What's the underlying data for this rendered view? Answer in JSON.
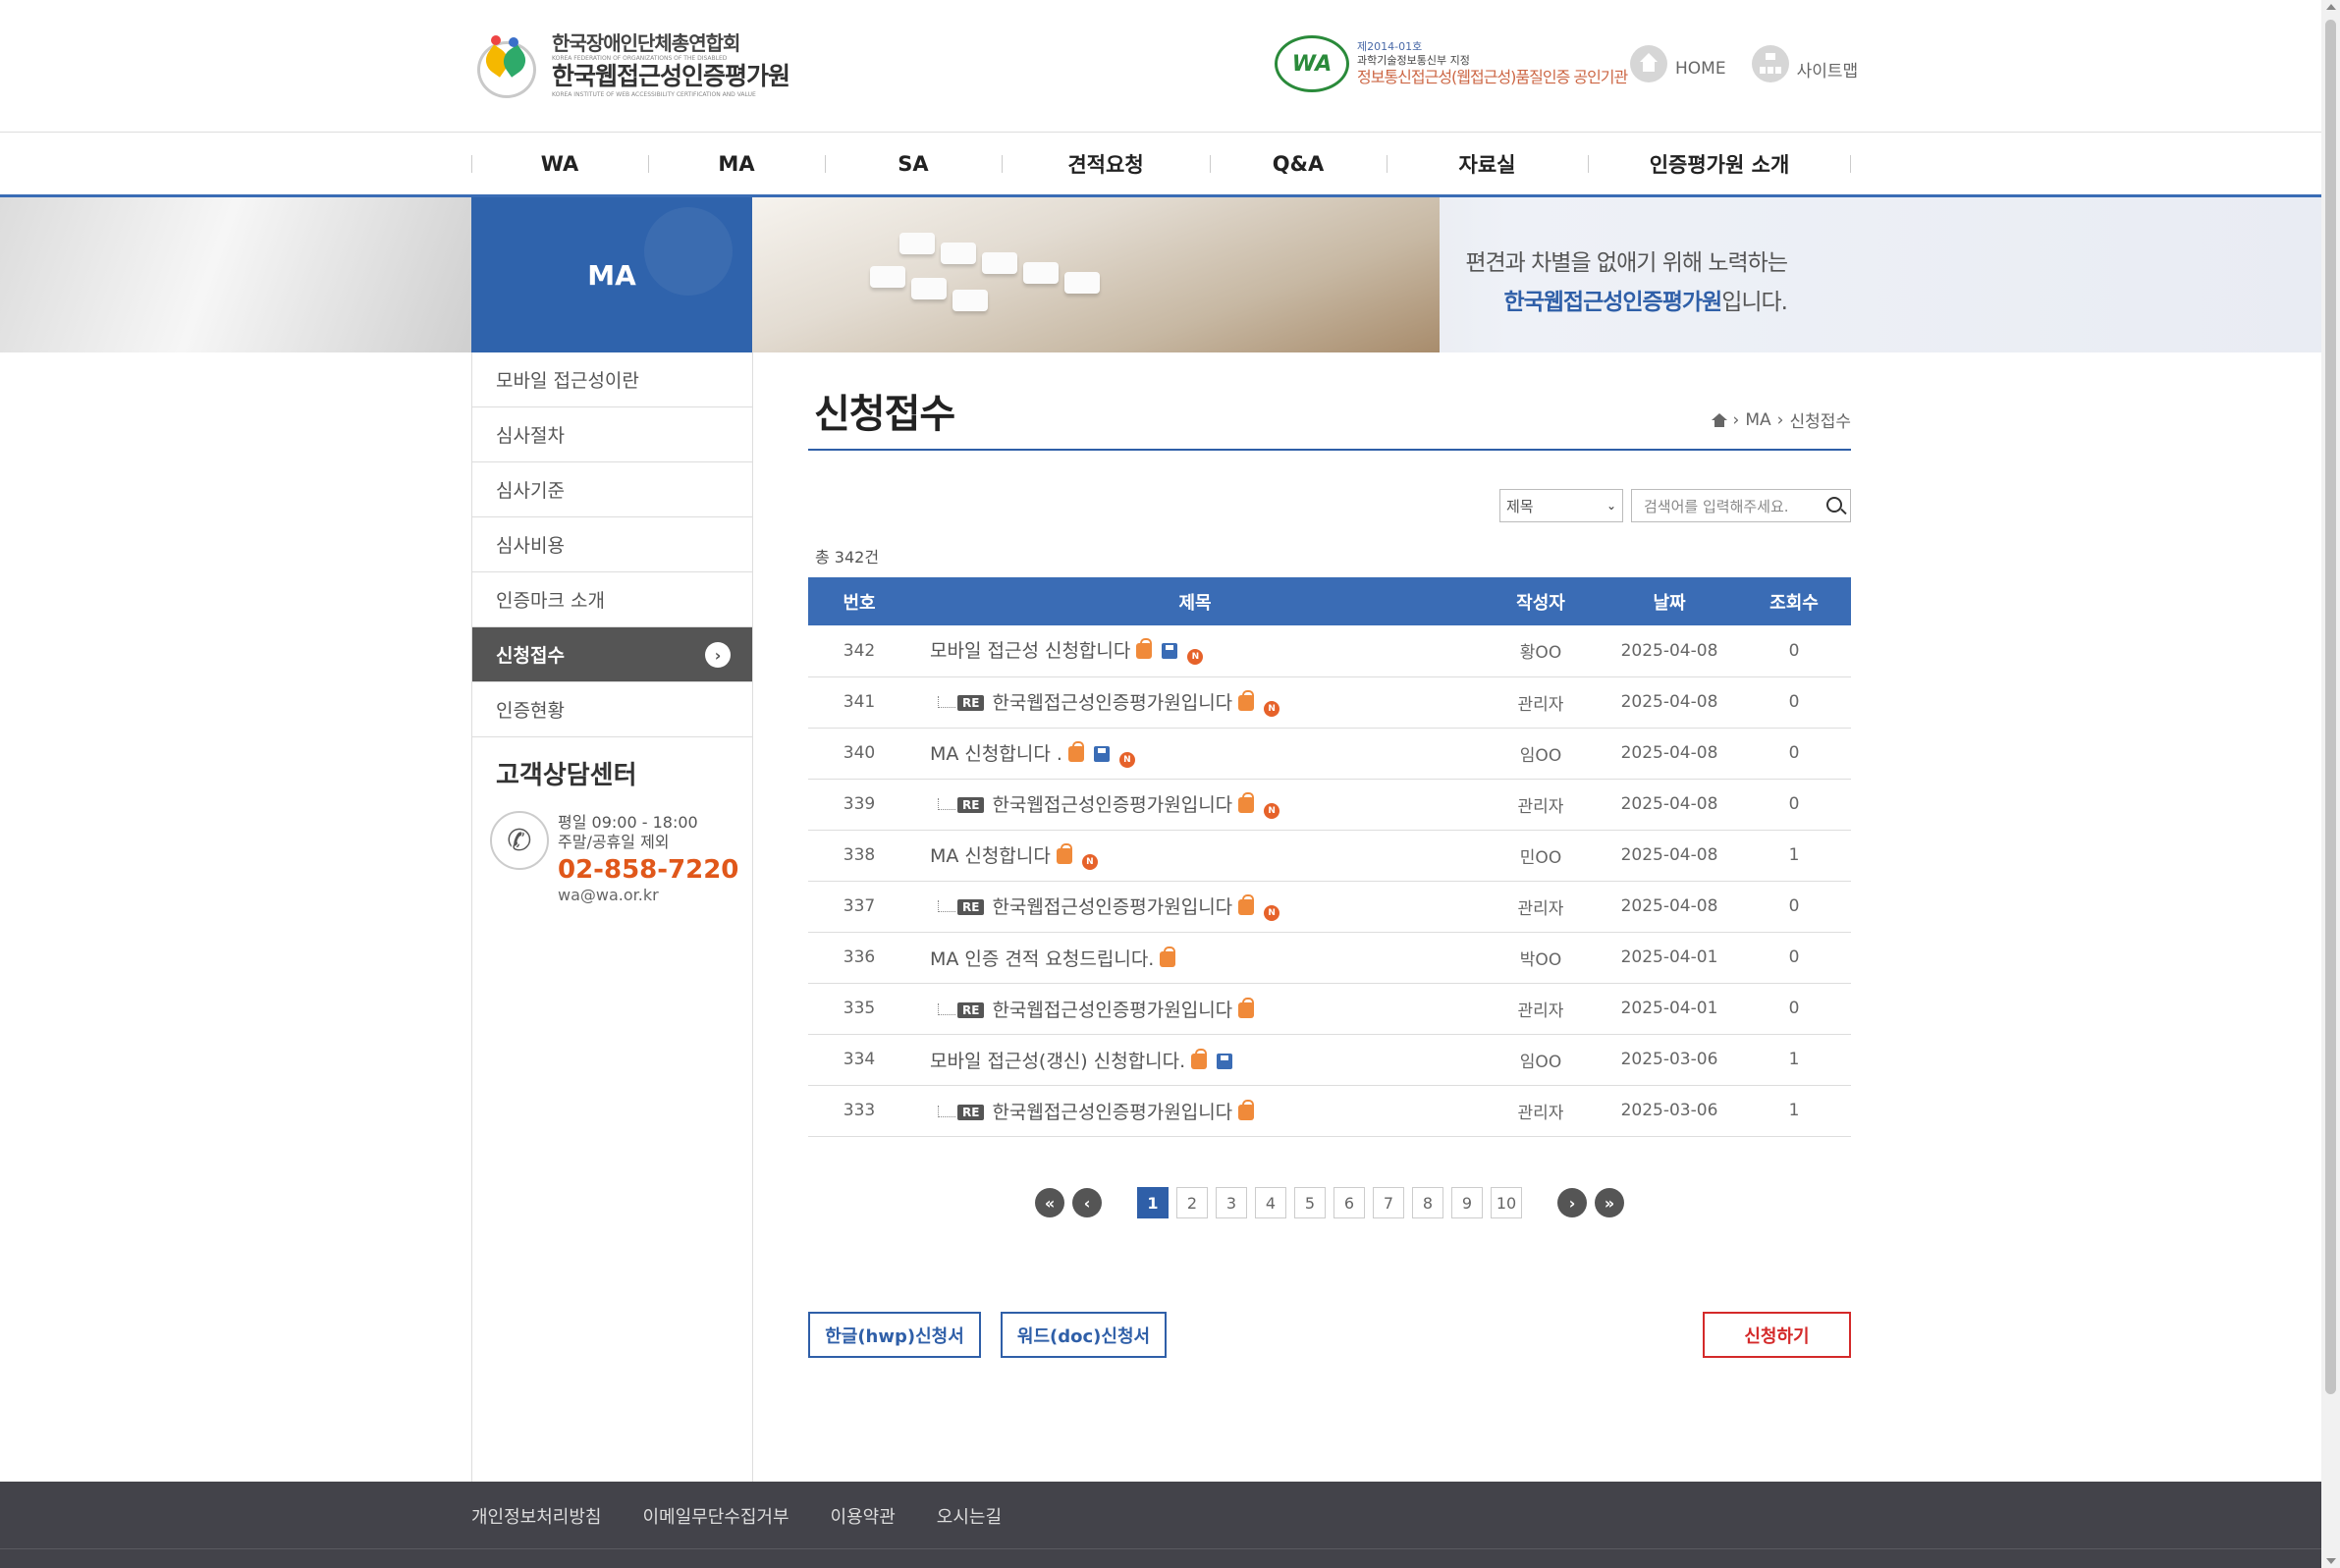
{
  "header": {
    "logo_line1": "한국장애인단체총연합회",
    "logo_line1_en": "KOREA FEDERATION OF ORGANIZATIONS OF THE DISABLED",
    "logo_line2": "한국웹접근성인증평가원",
    "logo_line2_en": "KOREA INSTITUTE OF WEB ACCESSIBILITY CERTIFICATION AND VALUE",
    "badge_mark": "WA",
    "badge_line1": "제2014-01호",
    "badge_line2": "과학기술정보통신부 지정",
    "badge_line3": "정보통신접근성(웹접근성)품질인증 공인기관",
    "home_label": "HOME",
    "sitemap_label": "사이트맵"
  },
  "gnb": {
    "items": [
      "WA",
      "MA",
      "SA",
      "견적요청",
      "Q&A",
      "자료실",
      "인증평가원 소개"
    ]
  },
  "visual": {
    "section_label": "MA",
    "slogan_line1": "편견과 차별을 없애기 위해 노력하는",
    "slogan_line2_bold": "한국웹접근성인증평가원",
    "slogan_line2_rest": "입니다."
  },
  "sidebar": {
    "items": [
      {
        "label": "모바일 접근성이란",
        "active": false
      },
      {
        "label": "심사절차",
        "active": false
      },
      {
        "label": "심사기준",
        "active": false
      },
      {
        "label": "심사비용",
        "active": false
      },
      {
        "label": "인증마크 소개",
        "active": false
      },
      {
        "label": "신청접수",
        "active": true
      },
      {
        "label": "인증현황",
        "active": false
      }
    ],
    "cs_title": "고객상담센터",
    "cs_hours1": "평일 09:00 - 18:00",
    "cs_hours2": "주말/공휴일 제외",
    "cs_phone": "02-858-7220",
    "cs_email": "wa@wa.or.kr"
  },
  "content": {
    "page_title": "신청접수",
    "breadcrumb_section": "MA",
    "breadcrumb_current": "신청접수",
    "search_select": "제목",
    "search_placeholder": "검색어를 입력해주세요.",
    "total_text": "총 342건"
  },
  "board": {
    "headers": [
      "번호",
      "제목",
      "작성자",
      "날짜",
      "조회수"
    ],
    "rows": [
      {
        "no": "342",
        "title": "모바일 접근성 신청합니다",
        "reply": false,
        "file": true,
        "new": true,
        "author": "황OO",
        "date": "2025-04-08",
        "views": "0"
      },
      {
        "no": "341",
        "title": "한국웹접근성인증평가원입니다",
        "reply": true,
        "file": false,
        "new": true,
        "author": "관리자",
        "date": "2025-04-08",
        "views": "0"
      },
      {
        "no": "340",
        "title": "MA 신청합니다 .",
        "reply": false,
        "file": true,
        "new": true,
        "author": "임OO",
        "date": "2025-04-08",
        "views": "0"
      },
      {
        "no": "339",
        "title": "한국웹접근성인증평가원입니다",
        "reply": true,
        "file": false,
        "new": true,
        "author": "관리자",
        "date": "2025-04-08",
        "views": "0"
      },
      {
        "no": "338",
        "title": "MA 신청합니다",
        "reply": false,
        "file": false,
        "new": true,
        "author": "민OO",
        "date": "2025-04-08",
        "views": "1"
      },
      {
        "no": "337",
        "title": "한국웹접근성인증평가원입니다",
        "reply": true,
        "file": false,
        "new": true,
        "author": "관리자",
        "date": "2025-04-08",
        "views": "0"
      },
      {
        "no": "336",
        "title": "MA 인증 견적 요청드립니다.",
        "reply": false,
        "file": false,
        "new": false,
        "author": "박OO",
        "date": "2025-04-01",
        "views": "0"
      },
      {
        "no": "335",
        "title": "한국웹접근성인증평가원입니다",
        "reply": true,
        "file": false,
        "new": false,
        "author": "관리자",
        "date": "2025-04-01",
        "views": "0"
      },
      {
        "no": "334",
        "title": "모바일 접근성(갱신) 신청합니다.",
        "reply": false,
        "file": true,
        "new": false,
        "author": "임OO",
        "date": "2025-03-06",
        "views": "1"
      },
      {
        "no": "333",
        "title": "한국웹접근성인증평가원입니다",
        "reply": true,
        "file": false,
        "new": false,
        "author": "관리자",
        "date": "2025-03-06",
        "views": "1"
      }
    ],
    "re_badge": "RE",
    "new_badge": "N"
  },
  "pager": {
    "pages": [
      "1",
      "2",
      "3",
      "4",
      "5",
      "6",
      "7",
      "8",
      "9",
      "10"
    ],
    "current": "1",
    "first": "«",
    "prev": "‹",
    "next": "›",
    "last": "»"
  },
  "buttons": {
    "hwp": "한글(hwp)신청서",
    "doc": "워드(doc)신청서",
    "apply": "신청하기"
  },
  "footer": {
    "links": [
      "개인정보처리방침",
      "이메일무단수집거부",
      "이용약관",
      "오시는길"
    ]
  }
}
